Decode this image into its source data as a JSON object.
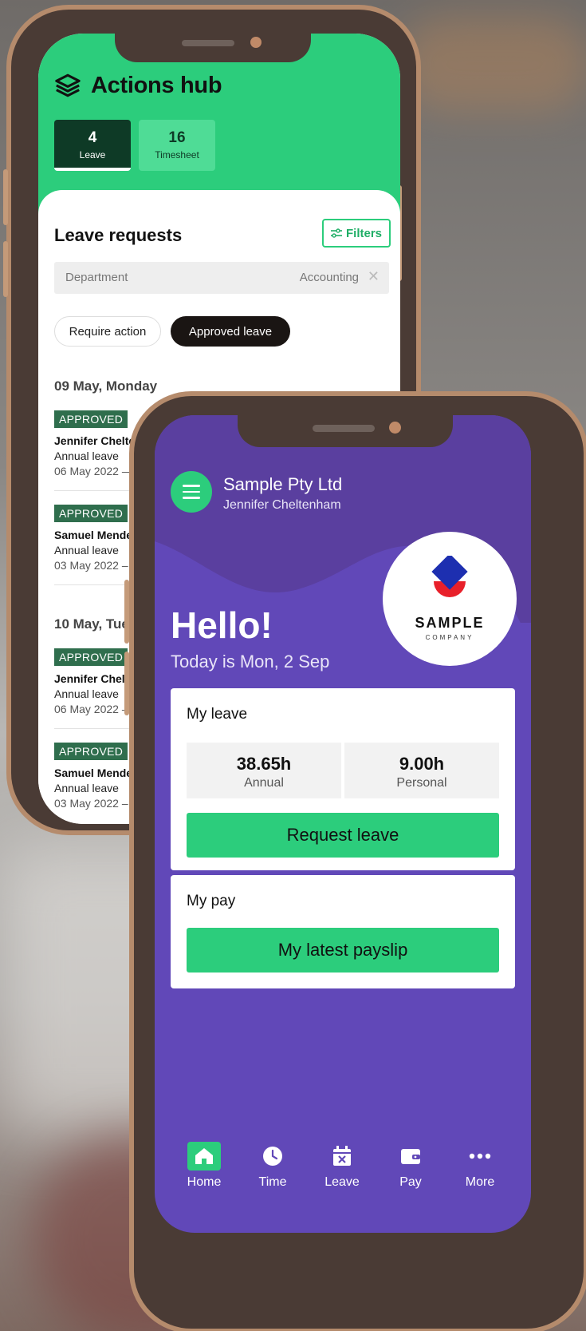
{
  "back_phone": {
    "header": {
      "title": "Actions hub",
      "icon": "layers-icon",
      "tabs": [
        {
          "count": "4",
          "label": "Leave",
          "active": true
        },
        {
          "count": "16",
          "label": "Timesheet",
          "active": false
        }
      ]
    },
    "leave_requests": {
      "title": "Leave requests",
      "filters_label": "Filters",
      "department_label": "Department",
      "department_value": "Accounting",
      "pills": {
        "require_action": "Require action",
        "approved_leave": "Approved leave"
      },
      "groups": [
        {
          "day": "09 May, Monday",
          "entries": [
            {
              "status": "APPROVED",
              "name": "Jennifer Cheltenha",
              "type": "Annual leave",
              "dates": "06 May 2022 —"
            },
            {
              "status": "APPROVED",
              "name": "Samuel Mende",
              "type": "Annual leave",
              "dates": "03 May 2022 –"
            }
          ]
        },
        {
          "day": "10 May, Tues",
          "entries": [
            {
              "status": "APPROVED",
              "name": "Jennifer Chelte",
              "type": "Annual leave",
              "dates": "06 May 2022 –"
            },
            {
              "status": "APPROVED",
              "name": "Samuel Mende",
              "type": "Annual leave",
              "dates": "03 May 2022 –"
            }
          ]
        }
      ]
    },
    "colors": {
      "accent": "#2ccd7c",
      "badge": "#2f6e4d",
      "tab_active": "#0e3a26"
    }
  },
  "front_phone": {
    "header": {
      "company": "Sample Pty Ltd",
      "user": "Jennifer Cheltenham"
    },
    "logo": {
      "word": "SAMPLE",
      "sub": "COMPANY"
    },
    "greeting": "Hello!",
    "today": "Today is Mon, 2 Sep",
    "my_leave": {
      "title": "My leave",
      "balances": [
        {
          "value": "38.65h",
          "label": "Annual"
        },
        {
          "value": "9.00h",
          "label": "Personal"
        }
      ],
      "button": "Request leave"
    },
    "my_pay": {
      "title": "My pay",
      "button": "My latest payslip"
    },
    "nav": [
      {
        "label": "Home",
        "icon": "home-icon",
        "active": true
      },
      {
        "label": "Time",
        "icon": "clock-icon",
        "active": false
      },
      {
        "label": "Leave",
        "icon": "calendar-x-icon",
        "active": false
      },
      {
        "label": "Pay",
        "icon": "wallet-icon",
        "active": false
      },
      {
        "label": "More",
        "icon": "more-dots-icon",
        "active": false
      }
    ],
    "colors": {
      "primary": "#6148b8",
      "accent": "#2ccd7c"
    }
  }
}
